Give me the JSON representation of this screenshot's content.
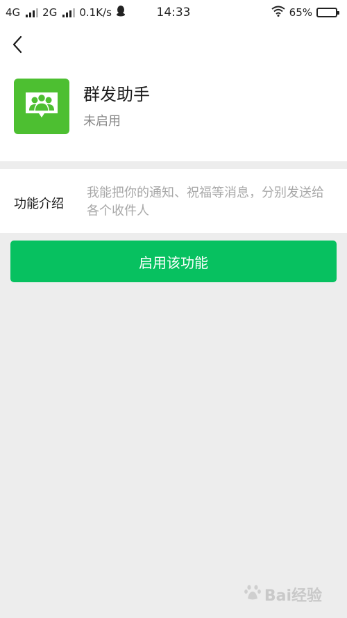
{
  "status_bar": {
    "network1": "4G",
    "network2": "2G",
    "speed": "0.1K/s",
    "time": "14:33",
    "battery": "65%",
    "battery_level": 0.65
  },
  "app": {
    "title": "群发助手",
    "status": "未启用",
    "icon_color": "#4dbf31"
  },
  "intro": {
    "label": "功能介绍",
    "text": "我能把你的通知、祝福等消息，分别发送给各个收件人"
  },
  "enable_button": {
    "label": "启用该功能",
    "color": "#07c160"
  },
  "watermark": {
    "text": "Bai经验"
  }
}
